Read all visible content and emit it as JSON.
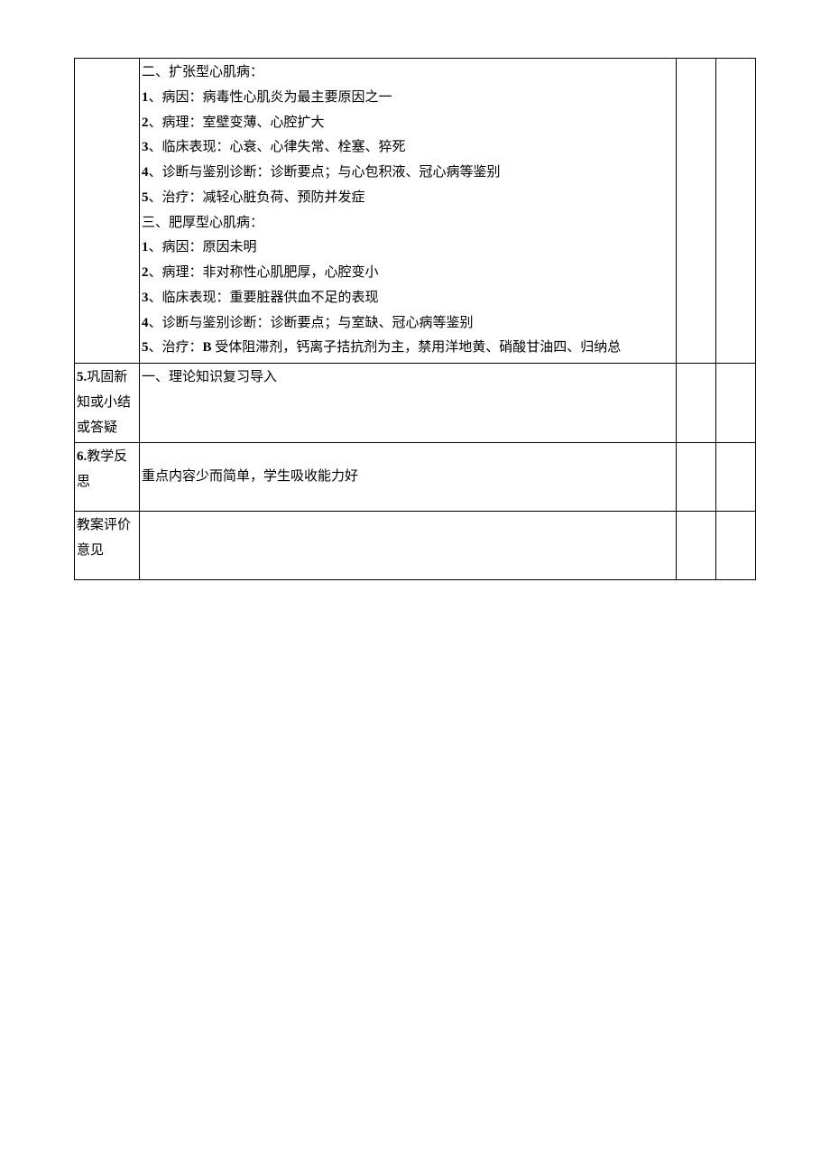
{
  "row1": {
    "lines": [
      "二、扩张型心肌病：",
      "1、病因：病毒性心肌炎为最主要原因之一",
      "2、病理：室壁变薄、心腔扩大",
      "3、临床表现：心衰、心律失常、栓塞、猝死",
      "4、诊断与鉴别诊断：诊断要点；与心包积液、冠心病等鉴别",
      "5、治疗：减轻心脏负荷、预防并发症",
      "三、肥厚型心肌病：",
      "1、病因：原因未明",
      "2、病理：非对称性心肌肥厚，心腔变小",
      "3、临床表现：重要脏器供血不足的表现",
      "4、诊断与鉴别诊断：诊断要点；与室缺、冠心病等鉴别"
    ],
    "last_prefix": "5",
    "last_rest": "、治疗：",
    "last_bold": "B",
    "last_tail": " 受体阻滞剂，钙离子拮抗剂为主，禁用洋地黄、硝酸甘油四、归纳总"
  },
  "row2": {
    "label_prefix": "5.",
    "label_rest": "巩固新知或小结或答疑",
    "content": "一、理论知识复习导入"
  },
  "row3": {
    "label_prefix": "6.",
    "label_rest": "教学反思",
    "content": "重点内容少而简单，学生吸收能力好"
  },
  "row4": {
    "label": "教案评价意见"
  }
}
